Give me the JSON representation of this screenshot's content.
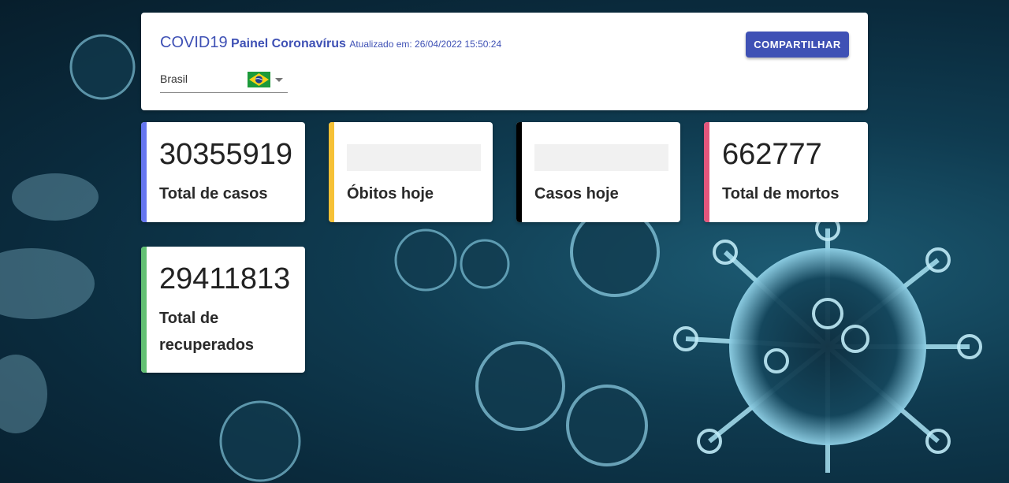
{
  "header": {
    "title_main": "COVID19",
    "title_sub": "Painel Coronavírus",
    "updated": "Atualizado em: 26/04/2022 15:50:24",
    "share_label": "COMPARTILHAR",
    "country": "Brasil",
    "flag_icon": "brazil-flag-icon"
  },
  "cards": [
    {
      "value": "30355919",
      "label": "Total de casos",
      "color": "#6576f0"
    },
    {
      "value": "",
      "label": "Óbitos hoje",
      "color": "#f6c136"
    },
    {
      "value": "",
      "label": "Casos hoje",
      "color": "#000000"
    },
    {
      "value": "662777",
      "label": "Total de mortos",
      "color": "#e3567c"
    },
    {
      "value": "29411813",
      "label": "Total de recuperados",
      "color": "#62c073"
    }
  ]
}
